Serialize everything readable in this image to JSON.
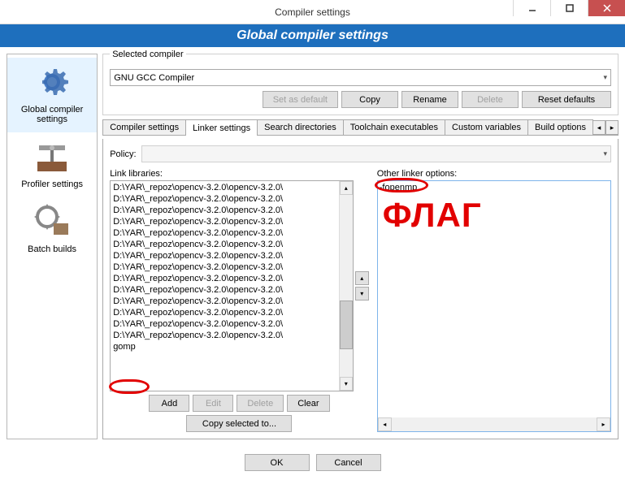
{
  "window": {
    "title": "Compiler settings"
  },
  "header": {
    "title": "Global compiler settings"
  },
  "sidebar": {
    "items": [
      {
        "label": "Global compiler settings"
      },
      {
        "label": "Profiler settings"
      },
      {
        "label": "Batch builds"
      }
    ]
  },
  "selected_compiler": {
    "legend": "Selected compiler",
    "value": "GNU GCC Compiler",
    "buttons": {
      "set_default": "Set as default",
      "copy": "Copy",
      "rename": "Rename",
      "delete": "Delete",
      "reset": "Reset defaults"
    }
  },
  "tabs": {
    "items": [
      "Compiler settings",
      "Linker settings",
      "Search directories",
      "Toolchain executables",
      "Custom variables",
      "Build options"
    ],
    "active_index": 1
  },
  "policy": {
    "label": "Policy:"
  },
  "link_libraries": {
    "label": "Link libraries:",
    "items": [
      "D:\\YAR\\_repoz\\opencv-3.2.0\\opencv-3.2.0\\",
      "D:\\YAR\\_repoz\\opencv-3.2.0\\opencv-3.2.0\\",
      "D:\\YAR\\_repoz\\opencv-3.2.0\\opencv-3.2.0\\",
      "D:\\YAR\\_repoz\\opencv-3.2.0\\opencv-3.2.0\\",
      "D:\\YAR\\_repoz\\opencv-3.2.0\\opencv-3.2.0\\",
      "D:\\YAR\\_repoz\\opencv-3.2.0\\opencv-3.2.0\\",
      "D:\\YAR\\_repoz\\opencv-3.2.0\\opencv-3.2.0\\",
      "D:\\YAR\\_repoz\\opencv-3.2.0\\opencv-3.2.0\\",
      "D:\\YAR\\_repoz\\opencv-3.2.0\\opencv-3.2.0\\",
      "D:\\YAR\\_repoz\\opencv-3.2.0\\opencv-3.2.0\\",
      "D:\\YAR\\_repoz\\opencv-3.2.0\\opencv-3.2.0\\",
      "D:\\YAR\\_repoz\\opencv-3.2.0\\opencv-3.2.0\\",
      "D:\\YAR\\_repoz\\opencv-3.2.0\\opencv-3.2.0\\",
      "D:\\YAR\\_repoz\\opencv-3.2.0\\opencv-3.2.0\\",
      "gomp"
    ],
    "buttons": {
      "add": "Add",
      "edit": "Edit",
      "delete": "Delete",
      "clear": "Clear",
      "copy_to": "Copy selected to..."
    }
  },
  "other_linker": {
    "label": "Other linker options:",
    "value": "-fopenmp"
  },
  "annotations": {
    "flag": "ФЛАГ"
  },
  "bottom": {
    "ok": "OK",
    "cancel": "Cancel"
  }
}
